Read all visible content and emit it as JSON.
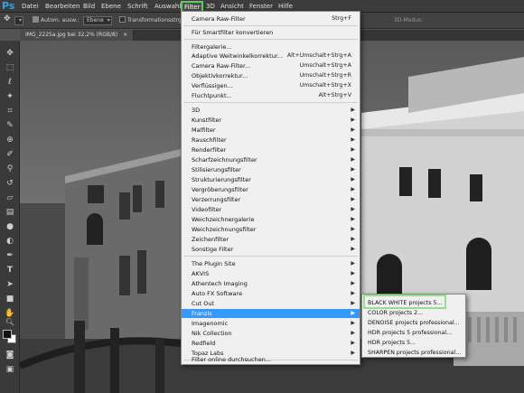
{
  "app": {
    "logo": "Ps"
  },
  "menubar": {
    "items": [
      {
        "label": "Datei"
      },
      {
        "label": "Bearbeiten"
      },
      {
        "label": "Bild"
      },
      {
        "label": "Ebene"
      },
      {
        "label": "Schrift"
      },
      {
        "label": "Auswahl"
      },
      {
        "label": "Filter"
      },
      {
        "label": "3D"
      },
      {
        "label": "Ansicht"
      },
      {
        "label": "Fenster"
      },
      {
        "label": "Hilfe"
      }
    ],
    "active": "Filter"
  },
  "options": {
    "auto_select_label": "Autom. ausw.:",
    "auto_select_value": "Ebene",
    "transform_label": "Transformationsstrg.",
    "mode_label": "3D-Modus:"
  },
  "document": {
    "tab_title": "IMG_2225a.jpg bei 32,2% (RGB/8)"
  },
  "filter_menu": {
    "items": [
      {
        "label": "Camera Raw-Filter",
        "shortcut": "Strg+F"
      },
      {
        "label": "Für Smartfilter konvertieren"
      },
      {
        "label": "Filtergalerie..."
      },
      {
        "label": "Adaptive Weitwinkelkorrektur...",
        "shortcut": "Alt+Umschalt+Strg+A"
      },
      {
        "label": "Camera Raw-Filter...",
        "shortcut": "Umschalt+Strg+A"
      },
      {
        "label": "Objektivkorrektur...",
        "shortcut": "Umschalt+Strg+R"
      },
      {
        "label": "Verflüssigen...",
        "shortcut": "Umschalt+Strg+X"
      },
      {
        "label": "Fluchtpunkt...",
        "shortcut": "Alt+Strg+V"
      },
      {
        "label": "3D"
      },
      {
        "label": "Kunstfilter"
      },
      {
        "label": "Malfilter"
      },
      {
        "label": "Rauschfilter"
      },
      {
        "label": "Renderfilter"
      },
      {
        "label": "Scharfzeichnungsfilter"
      },
      {
        "label": "Stilisierungsfilter"
      },
      {
        "label": "Strukturierungsfilter"
      },
      {
        "label": "Vergröberungsfilter"
      },
      {
        "label": "Verzerrungsfilter"
      },
      {
        "label": "Videofilter"
      },
      {
        "label": "Weichzeichnergalerie"
      },
      {
        "label": "Weichzeichnungsfilter"
      },
      {
        "label": "Zeichenfilter"
      },
      {
        "label": "Sonstige Filter"
      },
      {
        "label": "The Plugin Site"
      },
      {
        "label": "AKVIS"
      },
      {
        "label": "Athentech Imaging"
      },
      {
        "label": "Auto FX Software"
      },
      {
        "label": "Cut Out"
      },
      {
        "label": "Franzis"
      },
      {
        "label": "Imagenomic"
      },
      {
        "label": "Nik Collection"
      },
      {
        "label": "Redfield"
      },
      {
        "label": "Topaz Labs"
      },
      {
        "label": "Filter online durchsuchen..."
      }
    ],
    "highlighted": "Franzis"
  },
  "franzis_submenu": {
    "items": [
      {
        "label": "BLACK WHITE projects 5..."
      },
      {
        "label": "COLOR projects 2..."
      },
      {
        "label": "DENOISE projects professional..."
      },
      {
        "label": "HDR projects 5 professional..."
      },
      {
        "label": "HDR projects 5..."
      },
      {
        "label": "SHARPEN projects professional..."
      }
    ]
  },
  "colors": {
    "accent_outline": "#5ecb5e",
    "highlight": "#3399ff",
    "ps_blue": "#32a0e6"
  },
  "icons": {
    "tools": [
      "move-icon",
      "marquee-icon",
      "lasso-icon",
      "magic-wand-icon",
      "crop-icon",
      "eyedropper-icon",
      "healing-brush-icon",
      "brush-icon",
      "clone-stamp-icon",
      "history-brush-icon",
      "eraser-icon",
      "gradient-icon",
      "blur-icon",
      "dodge-icon",
      "pen-icon",
      "type-icon",
      "path-select-icon",
      "shape-icon",
      "hand-icon",
      "zoom-icon"
    ]
  }
}
